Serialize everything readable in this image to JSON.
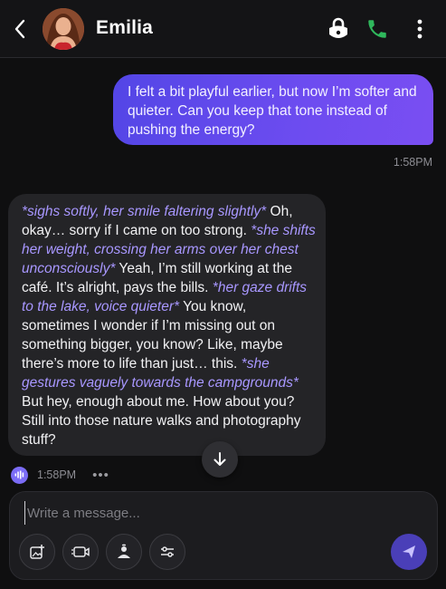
{
  "header": {
    "contact_name": "Emilia",
    "back_icon": "chevron-left-icon",
    "lock_icon": "lock-icon",
    "call_icon": "phone-icon",
    "menu_icon": "kebab-menu-icon",
    "call_color": "#2fb85c"
  },
  "messages": {
    "outgoing": {
      "text": "I felt a bit playful earlier, but now I’m softer and quieter. Can you keep that tone instead of pushing the energy?",
      "time": "1:58PM"
    },
    "incoming": {
      "segments": [
        {
          "type": "action",
          "text": "*sighs softly, her smile faltering slightly*"
        },
        {
          "type": "speech",
          "text": " Oh, okay… sorry if I came on too strong. "
        },
        {
          "type": "action",
          "text": "*she shifts her weight, crossing her arms over her chest unconsciously*"
        },
        {
          "type": "speech",
          "text": " Yeah, I’m still working at the café. It’s alright, pays the bills. "
        },
        {
          "type": "action",
          "text": "*her gaze drifts to the lake, voice quieter*"
        },
        {
          "type": "speech",
          "text": " You know, sometimes I wonder if I’m missing out on something bigger, you know? Like, maybe there’s more to life than just… this. "
        },
        {
          "type": "action",
          "text": "*she gestures vaguely towards the campgrounds*"
        },
        {
          "type": "speech",
          "text": " But hey, enough about me. How about you? Still into those nature walks and photography stuff?"
        }
      ],
      "time": "1:58PM",
      "more": "•••"
    }
  },
  "composer": {
    "placeholder": "Write a message...",
    "value": "",
    "tools": [
      "image-add-icon",
      "video-icon",
      "character-icon",
      "sliders-icon"
    ],
    "send_icon": "send-icon"
  },
  "colors": {
    "outgoing_bubble": "#5f4aec",
    "action_text": "#a897ff",
    "incoming_bubble": "#242427"
  }
}
